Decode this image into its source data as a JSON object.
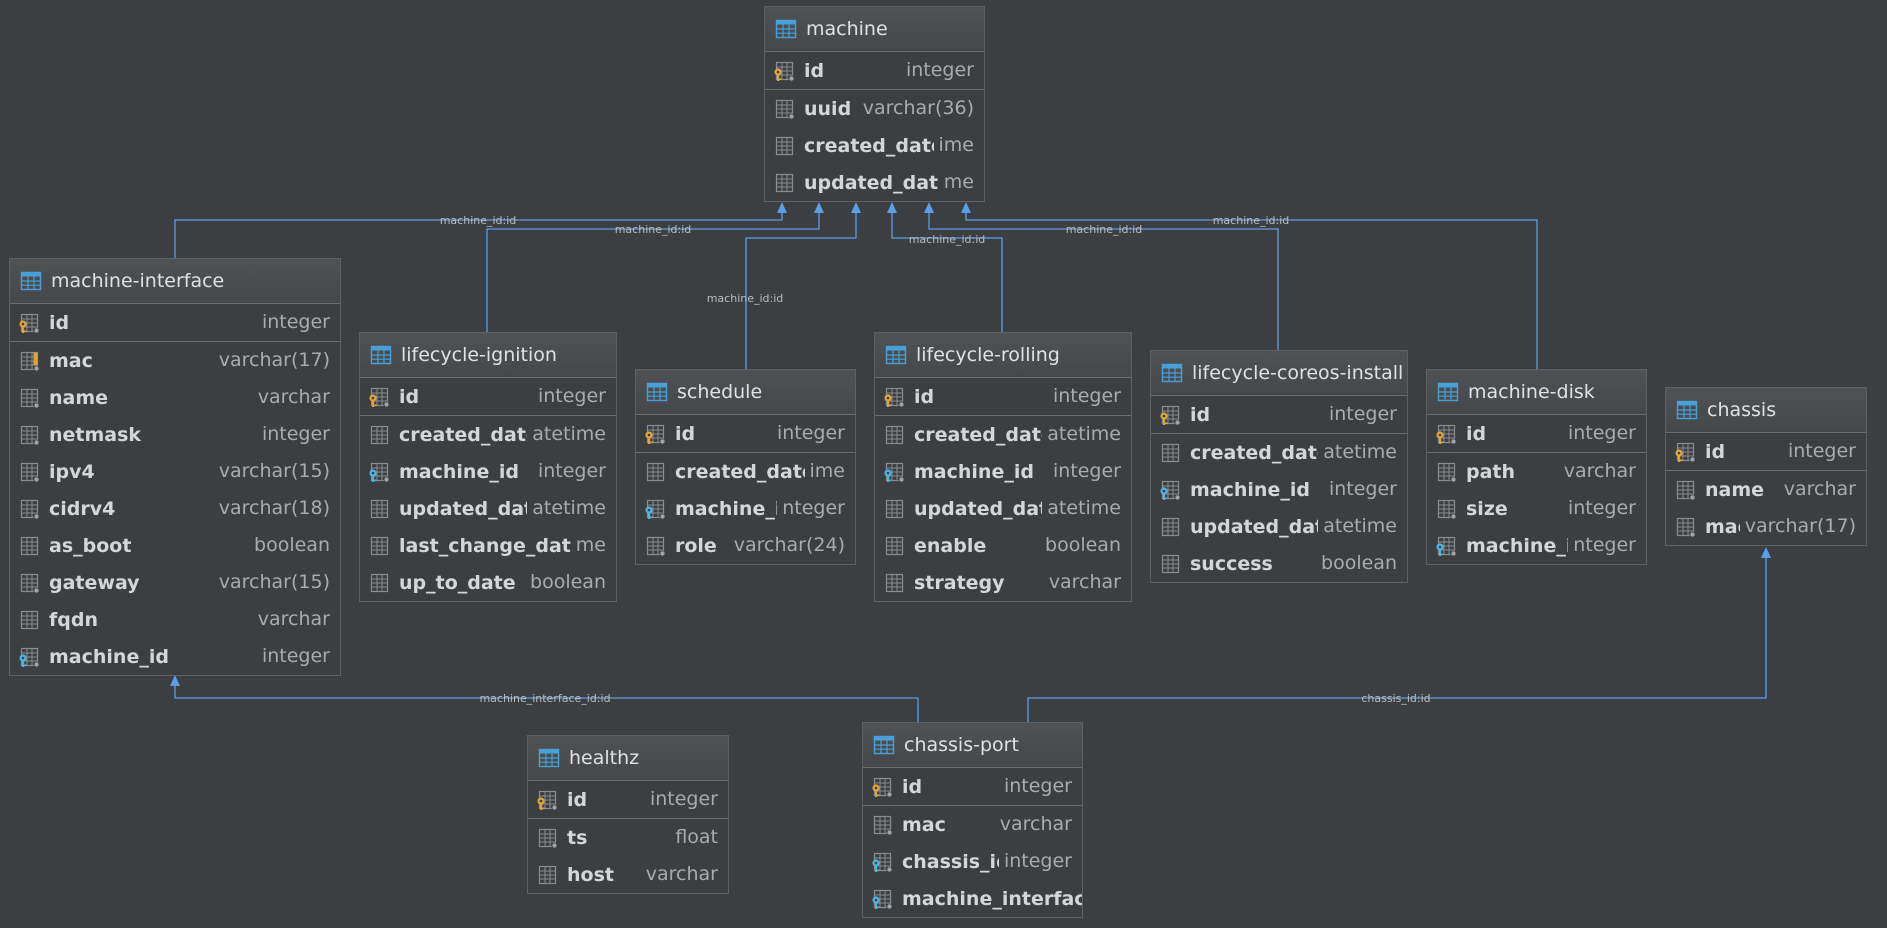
{
  "colors": {
    "background": "#3c3f41",
    "table_icon": "#48a0d8",
    "primary_key": "#e0a43a",
    "foreign_key": "#4fb3e0",
    "connector": "#5c9ee8"
  },
  "tables": {
    "machine": {
      "title": "machine",
      "columns": [
        {
          "name": "id",
          "type": "integer",
          "icon": "primary-key-icon"
        },
        {
          "name": "uuid",
          "type": "varchar(36)",
          "icon": "column-nn-icon"
        },
        {
          "name": "created_date",
          "type": "ime",
          "icon": "column-icon"
        },
        {
          "name": "updated_date",
          "type": "me",
          "icon": "column-icon"
        }
      ]
    },
    "machine_interface": {
      "title": "machine-interface",
      "columns": [
        {
          "name": "id",
          "type": "integer",
          "icon": "primary-key-icon"
        },
        {
          "name": "mac",
          "type": "varchar(17)",
          "icon": "unique-column-icon"
        },
        {
          "name": "name",
          "type": "varchar",
          "icon": "column-nn-icon"
        },
        {
          "name": "netmask",
          "type": "integer",
          "icon": "column-nn-icon"
        },
        {
          "name": "ipv4",
          "type": "varchar(15)",
          "icon": "column-nn-icon"
        },
        {
          "name": "cidrv4",
          "type": "varchar(18)",
          "icon": "column-nn-icon"
        },
        {
          "name": "as_boot",
          "type": "boolean",
          "icon": "column-icon"
        },
        {
          "name": "gateway",
          "type": "varchar(15)",
          "icon": "column-nn-icon"
        },
        {
          "name": "fqdn",
          "type": "varchar",
          "icon": "column-icon"
        },
        {
          "name": "machine_id",
          "type": "integer",
          "icon": "foreign-key-icon"
        }
      ]
    },
    "lifecycle_ignition": {
      "title": "lifecycle-ignition",
      "columns": [
        {
          "name": "id",
          "type": "integer",
          "icon": "primary-key-icon"
        },
        {
          "name": "created_date",
          "type": "atetime",
          "icon": "column-icon"
        },
        {
          "name": "machine_id",
          "type": "integer",
          "icon": "foreign-key-icon"
        },
        {
          "name": "updated_date",
          "type": "atetime",
          "icon": "column-icon"
        },
        {
          "name": "last_change_date",
          "type": "me",
          "icon": "column-icon"
        },
        {
          "name": "up_to_date",
          "type": "boolean",
          "icon": "column-icon"
        }
      ]
    },
    "schedule": {
      "title": "schedule",
      "columns": [
        {
          "name": "id",
          "type": "integer",
          "icon": "primary-key-icon"
        },
        {
          "name": "created_date",
          "type": "ime",
          "icon": "column-icon"
        },
        {
          "name": "machine_id",
          "type": "nteger",
          "icon": "foreign-key-icon"
        },
        {
          "name": "role",
          "type": "varchar(24)",
          "icon": "column-nn-icon"
        }
      ]
    },
    "lifecycle_rolling": {
      "title": "lifecycle-rolling",
      "columns": [
        {
          "name": "id",
          "type": "integer",
          "icon": "primary-key-icon"
        },
        {
          "name": "created_date",
          "type": "atetime",
          "icon": "column-icon"
        },
        {
          "name": "machine_id",
          "type": "integer",
          "icon": "foreign-key-icon"
        },
        {
          "name": "updated_date",
          "type": "atetime",
          "icon": "column-icon"
        },
        {
          "name": "enable",
          "type": "boolean",
          "icon": "column-icon"
        },
        {
          "name": "strategy",
          "type": "varchar",
          "icon": "column-icon"
        }
      ]
    },
    "lifecycle_coreos_install": {
      "title": "lifecycle-coreos-install",
      "columns": [
        {
          "name": "id",
          "type": "integer",
          "icon": "primary-key-icon"
        },
        {
          "name": "created_date",
          "type": "atetime",
          "icon": "column-icon"
        },
        {
          "name": "machine_id",
          "type": "integer",
          "icon": "foreign-key-icon"
        },
        {
          "name": "updated_date",
          "type": "atetime",
          "icon": "column-icon"
        },
        {
          "name": "success",
          "type": "boolean",
          "icon": "column-icon"
        }
      ]
    },
    "machine_disk": {
      "title": "machine-disk",
      "columns": [
        {
          "name": "id",
          "type": "integer",
          "icon": "primary-key-icon"
        },
        {
          "name": "path",
          "type": "varchar",
          "icon": "column-nn-icon"
        },
        {
          "name": "size",
          "type": "integer",
          "icon": "column-nn-icon"
        },
        {
          "name": "machine_id",
          "type": "nteger",
          "icon": "foreign-key-icon"
        }
      ]
    },
    "chassis": {
      "title": "chassis",
      "columns": [
        {
          "name": "id",
          "type": "integer",
          "icon": "primary-key-icon"
        },
        {
          "name": "name",
          "type": "varchar",
          "icon": "column-nn-icon"
        },
        {
          "name": "mac",
          "type": "varchar(17)",
          "icon": "column-nn-icon"
        }
      ]
    },
    "healthz": {
      "title": "healthz",
      "columns": [
        {
          "name": "id",
          "type": "integer",
          "icon": "primary-key-icon"
        },
        {
          "name": "ts",
          "type": "float",
          "icon": "column-nn-icon"
        },
        {
          "name": "host",
          "type": "varchar",
          "icon": "column-icon"
        }
      ]
    },
    "chassis_port": {
      "title": "chassis-port",
      "columns": [
        {
          "name": "id",
          "type": "integer",
          "icon": "primary-key-icon"
        },
        {
          "name": "mac",
          "type": "varchar",
          "icon": "column-nn-icon"
        },
        {
          "name": "chassis_id",
          "type": "integer",
          "icon": "foreign-key-icon"
        },
        {
          "name": "machine_interface_",
          "type": "",
          "icon": "foreign-key-icon"
        }
      ]
    }
  },
  "relations": {
    "machine_interface_machine": "machine_id:id",
    "lifecycle_ignition_machine": "machine_id:id",
    "schedule_machine": "machine_id:id",
    "lifecycle_rolling_machine": "machine_id:id",
    "lifecycle_coreos_install_machine": "machine_id:id",
    "machine_disk_machine": "machine_id:id",
    "chassis_port_machine_interface": "machine_interface_id:id",
    "chassis_port_chassis": "chassis_id:id"
  }
}
